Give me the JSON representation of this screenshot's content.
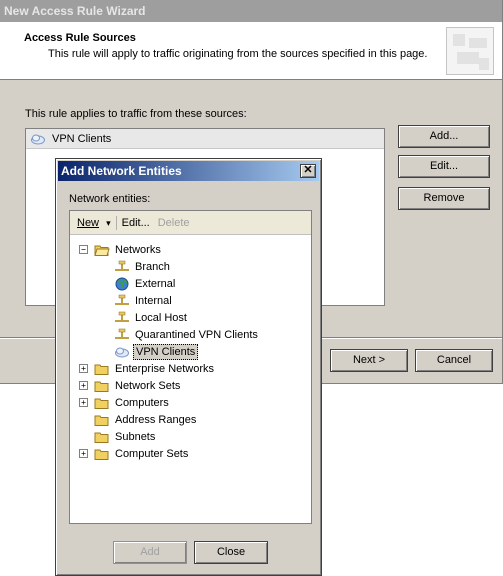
{
  "wizard": {
    "title": "New Access Rule Wizard",
    "header_title": "Access Rule Sources",
    "header_subtitle": "This rule will apply to traffic originating from the sources specified in this page.",
    "sources_label": "This rule applies to traffic from these sources:",
    "sources": [
      {
        "label": "VPN Clients",
        "icon": "vpn-clients-icon"
      }
    ],
    "buttons": {
      "add": "Add...",
      "edit": "Edit...",
      "remove": "Remove",
      "next": "Next >",
      "cancel": "Cancel"
    }
  },
  "dialog": {
    "title": "Add Network Entities",
    "close_glyph": "✕",
    "entities_label": "Network entities:",
    "toolbar": {
      "new": "New",
      "new_arrow": "▾",
      "edit": "Edit...",
      "delete": "Delete"
    },
    "tree": [
      {
        "label": "Networks",
        "icon": "folder-open-icon",
        "expander": "−",
        "level": 0
      },
      {
        "label": "Branch",
        "icon": "network-icon",
        "level": 1
      },
      {
        "label": "External",
        "icon": "globe-icon",
        "level": 1
      },
      {
        "label": "Internal",
        "icon": "network-icon",
        "level": 1
      },
      {
        "label": "Local Host",
        "icon": "network-icon",
        "level": 1
      },
      {
        "label": "Quarantined VPN Clients",
        "icon": "network-icon",
        "level": 1
      },
      {
        "label": "VPN Clients",
        "icon": "vpn-clients-icon",
        "level": 1,
        "selected": true
      },
      {
        "label": "Enterprise Networks",
        "icon": "folder-icon",
        "expander": "+",
        "level": 0
      },
      {
        "label": "Network Sets",
        "icon": "folder-icon",
        "expander": "+",
        "level": 0
      },
      {
        "label": "Computers",
        "icon": "folder-icon",
        "expander": "+",
        "level": 0
      },
      {
        "label": "Address Ranges",
        "icon": "folder-icon",
        "level": 0
      },
      {
        "label": "Subnets",
        "icon": "folder-icon",
        "level": 0
      },
      {
        "label": "Computer Sets",
        "icon": "folder-icon",
        "expander": "+",
        "level": 0
      }
    ],
    "buttons": {
      "add": "Add",
      "close": "Close"
    }
  },
  "colors": {
    "dialog_title_start": "#0a246a",
    "dialog_title_end": "#a6caf0",
    "inactive_title": "#9e9e9e",
    "folder": "#f0d060"
  }
}
